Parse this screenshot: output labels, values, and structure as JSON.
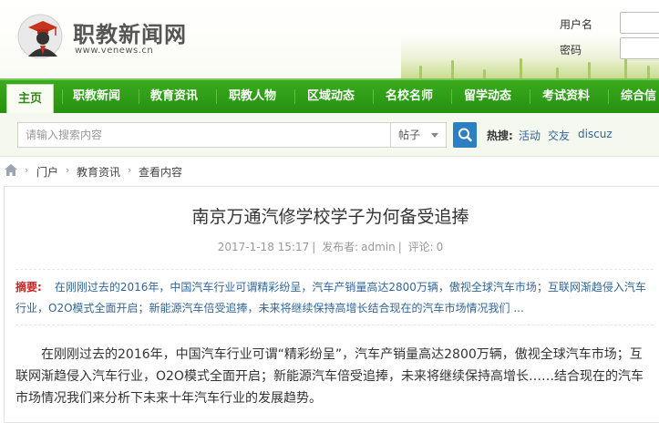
{
  "header": {
    "site_name": "职教新闻网",
    "site_url": "www.venews.cn",
    "username_label": "用户名",
    "password_label": "密码"
  },
  "nav": {
    "items": [
      {
        "label": "主页",
        "active": true
      },
      {
        "label": "职教新闻"
      },
      {
        "label": "教育资讯"
      },
      {
        "label": "职教人物"
      },
      {
        "label": "区域动态"
      },
      {
        "label": "名校名师"
      },
      {
        "label": "留学动态"
      },
      {
        "label": "考试资料"
      },
      {
        "label": "综合信"
      }
    ]
  },
  "search": {
    "placeholder": "请输入搜索内容",
    "type": "帖子",
    "hot_label": "热搜:",
    "hot_links": [
      "活动",
      "交友",
      "discuz"
    ]
  },
  "breadcrumb": [
    "门户",
    "教育资讯",
    "查看内容"
  ],
  "article": {
    "title": "南京万通汽修学校学子为何备受追捧",
    "date": "2017-1-18 15:17",
    "author_label": "发布者:",
    "author": "admin",
    "comments_label": "评论:",
    "comments": "0",
    "summary_label": "摘要:",
    "summary": "在刚刚过去的2016年，中国汽车行业可谓精彩纷呈，汽车产销量高达2800万辆，傲视全球汽车市场；互联网渐趋侵入汽车行业，O2O模式全面开启；新能源汽车倍受追捧，未来将继续保持高增长结合现在的汽车市场情况我们 ...",
    "body": "在刚刚过去的2016年，中国汽车行业可谓“精彩纷呈”，汽车产销量高达2800万辆，傲视全球汽车市场；互联网渐趋侵入汽车行业，O2O模式全面开启；新能源汽车倍受追捧，未来将继续保持高增长……结合现在的汽车市场情况我们来分析下未来十年汽车行业的发展趋势。"
  },
  "colors": {
    "nav_green": "#2f9c16",
    "link_blue": "#336699",
    "summary_red": "#cc2222",
    "search_button": "#2e7fc0"
  }
}
